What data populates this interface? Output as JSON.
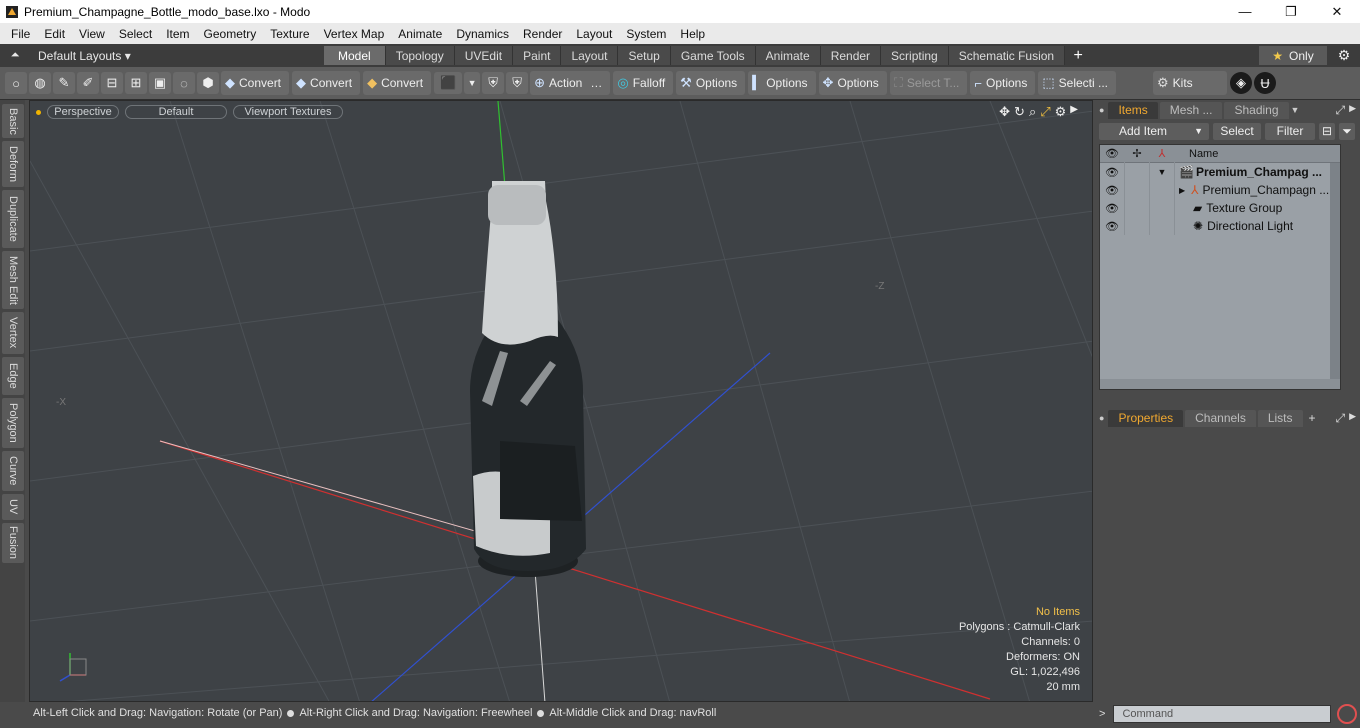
{
  "window": {
    "title": "Premium_Champagne_Bottle_modo_base.lxo - Modo",
    "minimize": "—",
    "maximize": "❐",
    "close": "✕"
  },
  "menu": [
    "File",
    "Edit",
    "View",
    "Select",
    "Item",
    "Geometry",
    "Texture",
    "Vertex Map",
    "Animate",
    "Dynamics",
    "Render",
    "Layout",
    "System",
    "Help"
  ],
  "layout": {
    "layouts_label": "Default Layouts ▾",
    "tabs": [
      "Model",
      "Topology",
      "UVEdit",
      "Paint",
      "Layout",
      "Setup",
      "Game Tools",
      "Animate",
      "Render",
      "Scripting",
      "Schematic Fusion"
    ],
    "active_tab": "Model",
    "plus": "+",
    "only_label": "Only"
  },
  "toolbar": {
    "convert": "Convert",
    "action": "Action",
    "falloff": "Falloff",
    "options": "Options",
    "select_t": "Select T...",
    "selecti": "Selecti ...",
    "kits": "Kits"
  },
  "left_tabs": [
    "Basic",
    "Deform",
    "Duplicate",
    "Mesh Edit",
    "Vertex",
    "Edge",
    "Polygon",
    "Curve",
    "UV",
    "Fusion"
  ],
  "viewport": {
    "view": "Perspective",
    "shading": "Default",
    "textures": "Viewport Textures",
    "info": {
      "no_items": "No Items",
      "polygons": "Polygons : Catmull-Clark",
      "channels": "Channels: 0",
      "deformers": "Deformers: ON",
      "gl": "GL: 1,022,496",
      "size": "20 mm"
    },
    "axis_z": "-Z",
    "axis_x": "-X"
  },
  "status": {
    "part1": "Alt-Left Click and Drag: Navigation: Rotate (or Pan)",
    "part2": "Alt-Right Click and Drag: Navigation: Freewheel",
    "part3": "Alt-Middle Click and Drag: navRoll"
  },
  "items_panel": {
    "tabs": [
      "Items",
      "Mesh ...",
      "Shading"
    ],
    "add_item": "Add Item",
    "select": "Select",
    "filter": "Filter",
    "col_name": "Name",
    "rows": [
      {
        "label": "Premium_Champag ...",
        "bold": true
      },
      {
        "label": "Premium_Champagn ...",
        "bold": false
      },
      {
        "label": "Texture Group",
        "bold": false
      },
      {
        "label": "Directional Light",
        "bold": false
      }
    ]
  },
  "props_panel": {
    "tabs": [
      "Properties",
      "Channels",
      "Lists"
    ],
    "plus": "+"
  },
  "command": {
    "placeholder": "Command"
  },
  "colors": {
    "accent": "#f0a830",
    "viewport_bg": "#3e4246",
    "axis_x": "#d03030",
    "axis_y": "#30c030",
    "axis_z": "#3050d0"
  }
}
